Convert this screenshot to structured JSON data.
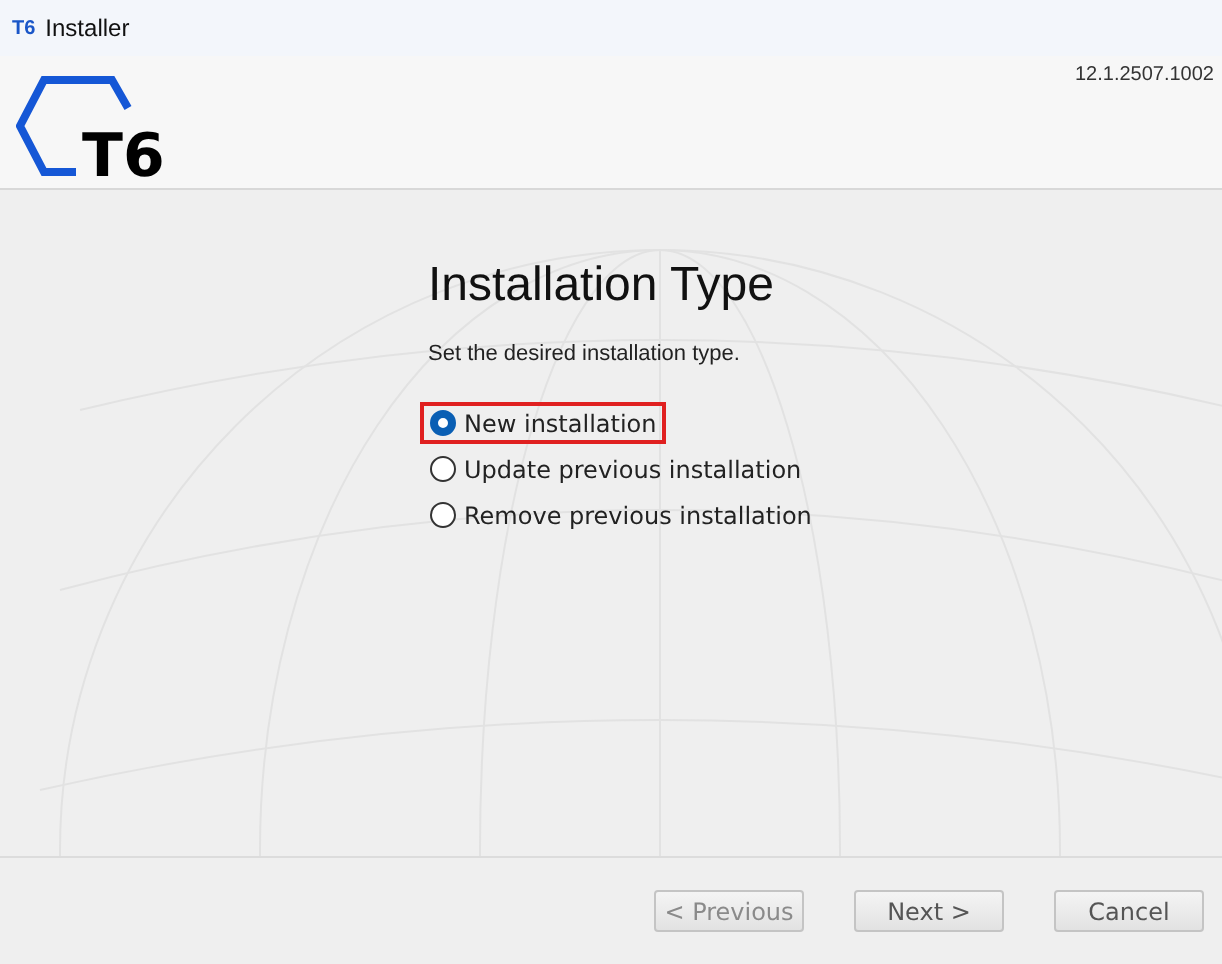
{
  "window": {
    "title": "Installer",
    "icon_text": "T6"
  },
  "header": {
    "logo_text": "T6",
    "version": "12.1.2507.1002"
  },
  "page": {
    "title": "Installation Type",
    "subtitle": "Set the desired installation type."
  },
  "options": [
    {
      "label": "New installation",
      "selected": true,
      "focused": true
    },
    {
      "label": "Update previous installation",
      "selected": false,
      "focused": false
    },
    {
      "label": "Remove previous installation",
      "selected": false,
      "focused": false
    }
  ],
  "buttons": [
    {
      "label": "< Previous",
      "disabled": true
    },
    {
      "label": "Next >",
      "disabled": false
    },
    {
      "label": "Cancel",
      "disabled": false
    }
  ]
}
